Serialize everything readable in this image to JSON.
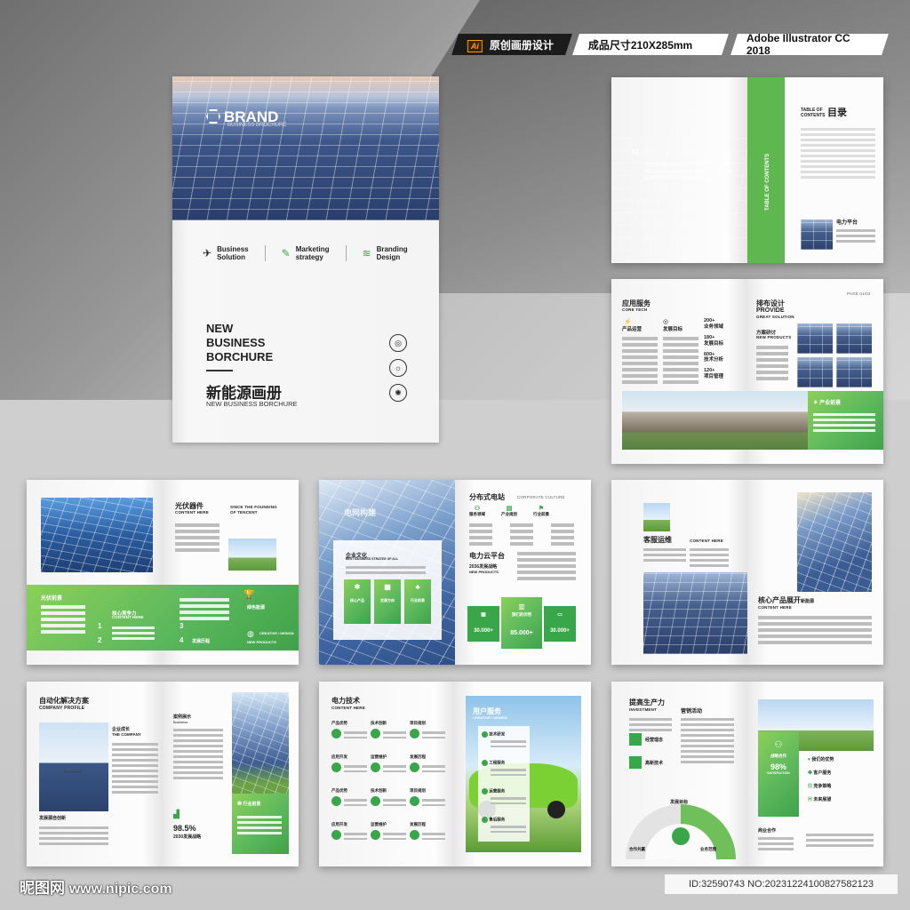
{
  "header": {
    "ai_badge": "Ai",
    "tag1": "原创画册设计",
    "tag2": "成品尺寸210X285mm",
    "tag3": "Adobe Illustrator CC 2018"
  },
  "cover": {
    "brand": "BRAND",
    "brand_sub": "BUSINESS BROCHURE",
    "features": [
      {
        "icon": "paper-plane-icon",
        "l1": "Business",
        "l2": "Solution"
      },
      {
        "icon": "pen-icon",
        "l1": "Marketing",
        "l2": "strategy"
      },
      {
        "icon": "layers-icon",
        "l1": "Branding",
        "l2": "Design"
      }
    ],
    "title_l1": "NEW",
    "title_l2": "BUSINESS",
    "title_l3": "BORCHURE",
    "title_cn": "新能源画册",
    "subtitle": "NEW BUSINESS BORCHURE"
  },
  "spread_toc": {
    "quote": "ADITAT AS SIM HARUPTA VOLO DEB ITIO NECULPA DESECATUL ALIBUS TE ODION EUM ARUPTIBUS CUM VOLORE",
    "vertical": "TABLE OF CONTENTS",
    "toc_en": "TABLE OF CONTENTS",
    "toc_cn": "目录",
    "item": "电力平台"
  },
  "spread_service": {
    "h1": "应用服务",
    "h1_en": "CORE TECH",
    "c1": "产品运营",
    "c2": "发展目标",
    "stats": [
      "200+",
      "业务领域",
      "180+",
      "发展目标",
      "600+",
      "技术分析",
      "120+",
      "项目管理"
    ],
    "h2": "排布设计",
    "h2_en": "PROVIDE",
    "h2_sub": "GREAT SOLUTION",
    "sub2": "方案研讨",
    "sub2_en": "NEW PRODUCTS",
    "page": "PAGE 01/02",
    "banner": "产业前景"
  },
  "spread_pv": {
    "title": "光伏器件",
    "title_en": "CONTENT HERE",
    "since": "SINCE THE FOUNDING",
    "since2": "OF TENCENT",
    "band_title": "光伏前景",
    "mid": "核心竞争力",
    "mid_en": "CONTENT HERE",
    "n1": "1",
    "n2": "2",
    "n3": "3",
    "n4": "4",
    "b1": "发展历程",
    "cap": "绿色能源",
    "cap2": "CREATIVE / DESIGN",
    "cap3": "NEW PRODUCTS"
  },
  "spread_dist": {
    "overlay": "电网构建",
    "card_title": "企业文化",
    "card_en": "BEST BUSINESS STRATEG OF ALL",
    "pills": [
      "核心产品",
      "发展方向",
      "行业前景"
    ],
    "h1": "分布式电站",
    "h1_en": "CORPORATE CULTURE",
    "icons": [
      "服务领域",
      "产业规划",
      "行业前景"
    ],
    "h2": "电力云平台",
    "h2_sub": "2036发展战略",
    "h2_en": "NEW PRODUCTS",
    "s1": "30.000+",
    "s2": "我们的优势",
    "s2v": "85.000+",
    "s3": "30.000+"
  },
  "spread_service2": {
    "h1": "客服运维",
    "h1_en": "CONTENT HERE",
    "h2": "核心产品展开",
    "h2b": "新能源",
    "h2_en": "CONTENT HERE"
  },
  "spread_auto": {
    "h1": "自动化解决方案",
    "h1_en": "COMPANY PROFILE",
    "growth": "企业成长",
    "growth_en": "THE COMPANY",
    "caption": "发展源自创新",
    "case": "案例展示",
    "case_en": "Business",
    "pct": "98.5%",
    "pct_sub": "2030发展战略",
    "badge": "行业前景"
  },
  "spread_tech": {
    "h1": "电力技术",
    "h1_en": "CONTENT HERE",
    "items": [
      "产品优势",
      "技术创新",
      "项目规划",
      "应用开发",
      "运营维护",
      "发展历程",
      "产品优势",
      "技术创新",
      "项目规划",
      "应用开发",
      "运营维护",
      "发展历程"
    ],
    "r_title": "用户服务",
    "r_en": "CREATIVE / DESIGN",
    "steps": [
      "技术研发",
      "工程服务",
      "运营服务",
      "售后服务"
    ]
  },
  "spread_prod": {
    "h1": "提高生产力",
    "h1_en": "INVESTMENT",
    "h2": "营销活动",
    "b1": "经营理念",
    "b2": "高新技术",
    "b3": "发展目标",
    "b4": "合作共赢",
    "b5": "业务范围",
    "card_title": "战略合作",
    "card_pct": "98%",
    "card_en": "SATISFACTION",
    "list": [
      "我们的优势",
      "客户服务",
      "竞争策略",
      "未来展望"
    ],
    "foot": "商业合作"
  },
  "footer": {
    "logo": "昵图网",
    "url": "www.nipic.com",
    "id": "ID:32590743 NO:20231224100827582123"
  }
}
